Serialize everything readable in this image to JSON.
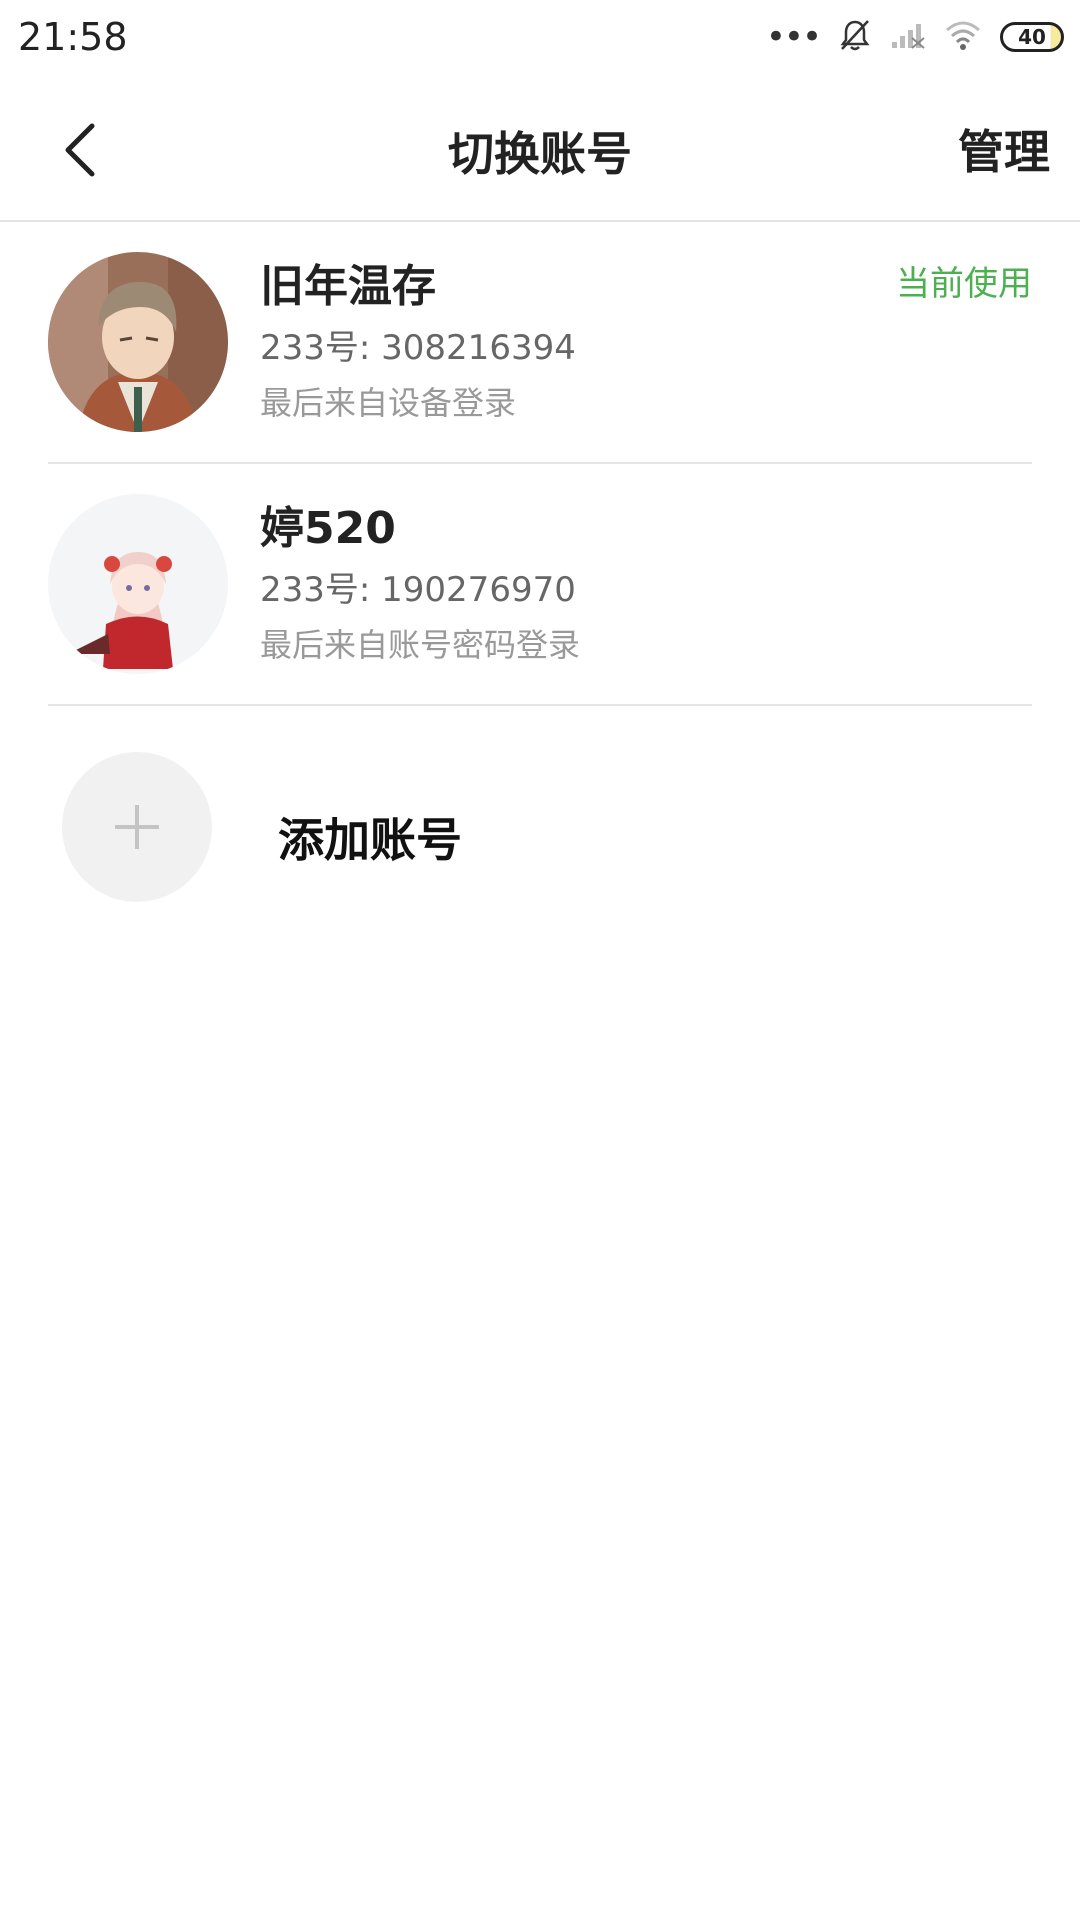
{
  "status_bar": {
    "time": "21:58",
    "dots": "•••",
    "battery": "40"
  },
  "header": {
    "title": "切换账号",
    "manage_label": "管理"
  },
  "accounts": [
    {
      "name": "旧年温存",
      "id": "233号: 308216394",
      "login": "最后来自设备登录",
      "badge": "当前使用"
    },
    {
      "name": "婷520",
      "id": "233号: 190276970",
      "login": "最后来自账号密码登录"
    }
  ],
  "add_account": {
    "label": "添加账号"
  },
  "colors": {
    "accent_green": "#4caf50",
    "divider": "#e6e6e6",
    "add_circle_bg": "#f1f1f1"
  }
}
